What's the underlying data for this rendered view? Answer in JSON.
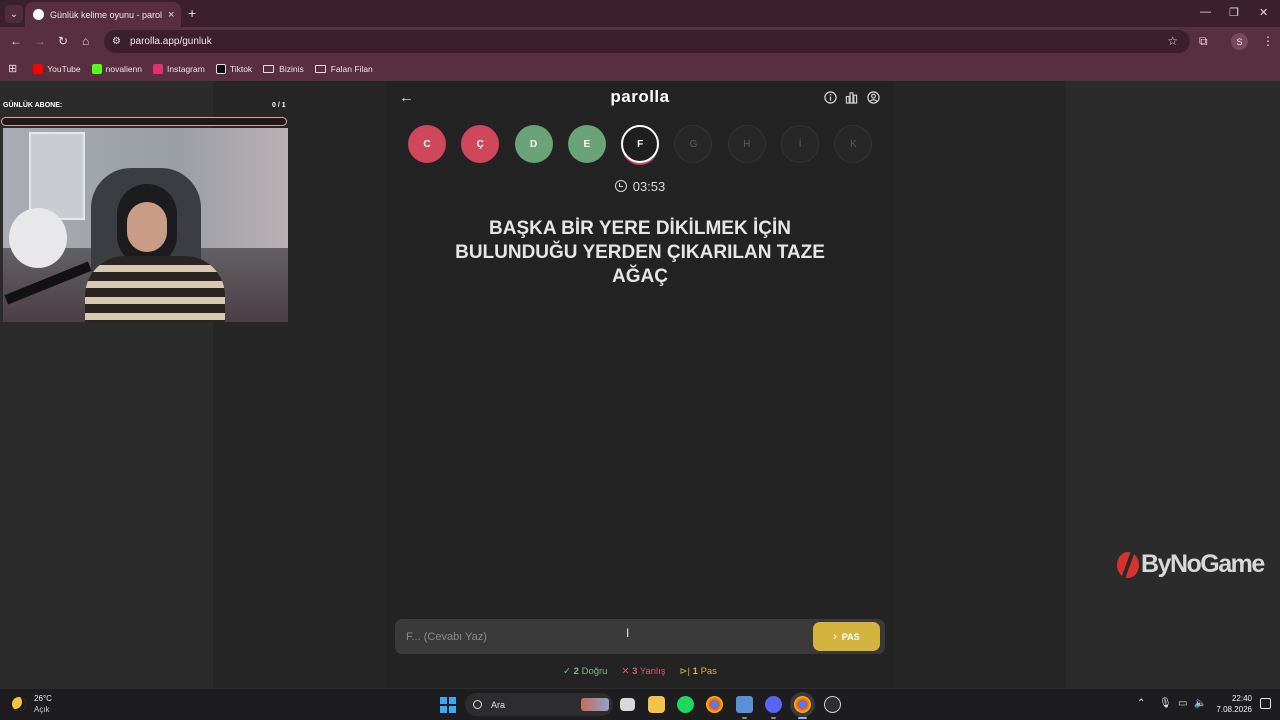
{
  "browser": {
    "tab_title": "Günlük kelime oyunu - parolla",
    "tab_close": "×",
    "new_tab": "+",
    "url": "parolla.app/gunluk",
    "profile_initial": "S",
    "bookmarks": [
      {
        "label": "YouTube",
        "color": "#ff0000"
      },
      {
        "label": "novalienn",
        "color": "#53fc18"
      },
      {
        "label": "Instagram",
        "color": "#e1306c"
      },
      {
        "label": "Tiktok",
        "color": "#111111"
      },
      {
        "label": "Bizinis",
        "icon": "folder-icon"
      },
      {
        "label": "Falan Filan",
        "icon": "folder-icon"
      }
    ]
  },
  "overlay": {
    "sub_label": "GÜNLÜK ABONE:",
    "sub_count": "0 / 1",
    "sub_progress": 0
  },
  "game": {
    "logo": "parolla",
    "letters": [
      {
        "char": "C",
        "state": "wrong"
      },
      {
        "char": "Ç",
        "state": "wrong"
      },
      {
        "char": "D",
        "state": "correct"
      },
      {
        "char": "E",
        "state": "correct"
      },
      {
        "char": "F",
        "state": "current"
      },
      {
        "char": "G",
        "state": "pending"
      },
      {
        "char": "H",
        "state": "pending"
      },
      {
        "char": "İ",
        "state": "pending"
      },
      {
        "char": "K",
        "state": "pending"
      }
    ],
    "timer": "03:53",
    "question": "BAŞKA BİR YERE DİKİLMEK İÇİN BULUNDUĞU YERDEN ÇIKARILAN TAZE AĞAÇ",
    "answer_placeholder": "F... (Cevabı Yaz)",
    "pass_button": "PAS",
    "stats": {
      "correct_count": "2",
      "correct_label": "Doğru",
      "wrong_count": "3",
      "wrong_label": "Yanlış",
      "pass_count": "1",
      "pass_label": "Pas"
    }
  },
  "watermark": "ByNoGame",
  "taskbar": {
    "temperature": "26°C",
    "condition": "Açık",
    "search_label": "Ara",
    "time": "22:40",
    "date": "7.08.2026"
  },
  "colors": {
    "wrong": "#d0475b",
    "correct": "#6aa377",
    "pass": "#d4b43f",
    "chrome": "#582f3f"
  }
}
